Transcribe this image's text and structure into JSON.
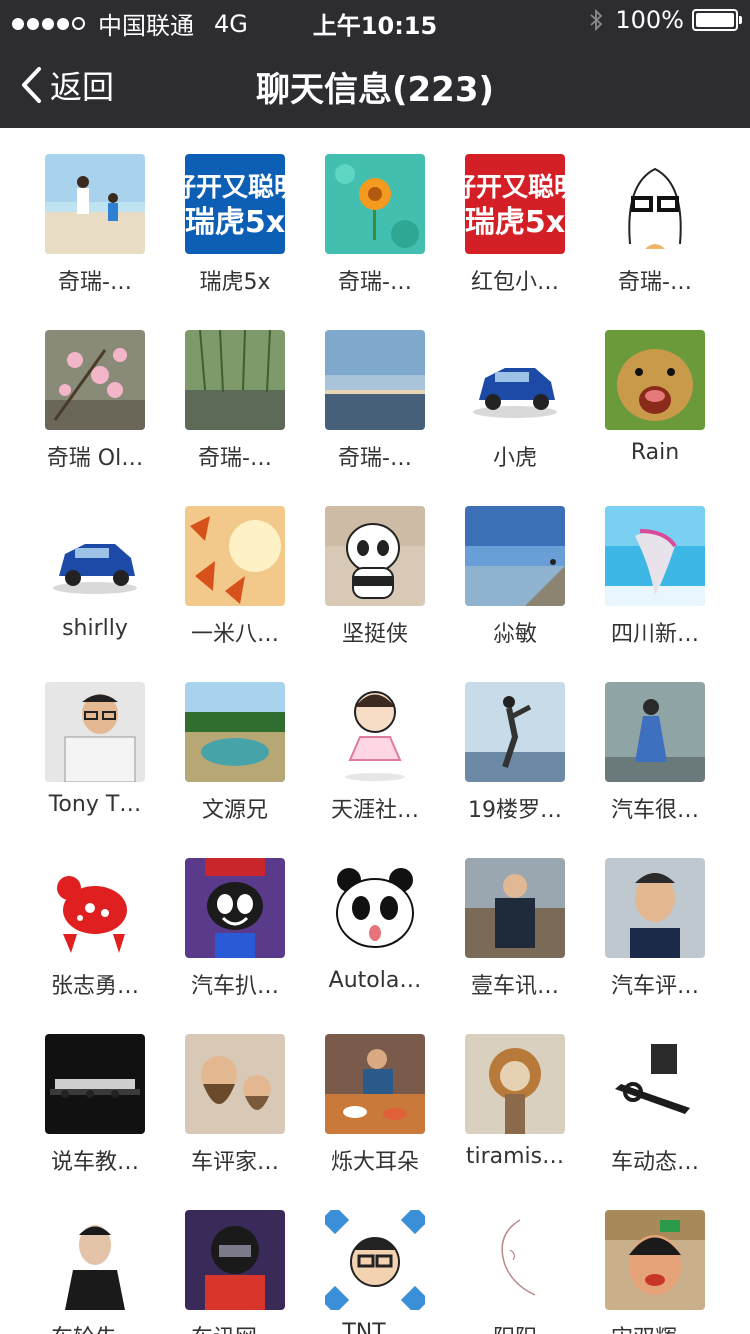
{
  "status_bar": {
    "carrier": "中国联通",
    "network": "4G",
    "time": "上午10:15",
    "battery": "100%"
  },
  "nav": {
    "back_label": "返回",
    "title": "聊天信息(223)"
  },
  "members": [
    {
      "name": "奇瑞-…",
      "avatar": "beach-photo"
    },
    {
      "name": "瑞虎5x",
      "avatar": "ruihu-logo-blue"
    },
    {
      "name": "奇瑞-…",
      "avatar": "flower-water"
    },
    {
      "name": "红包小…",
      "avatar": "ruihu-logo-red"
    },
    {
      "name": "奇瑞-…",
      "avatar": "sketch-girl"
    },
    {
      "name": "奇瑞 Ol…",
      "avatar": "blossom-photo"
    },
    {
      "name": "奇瑞-…",
      "avatar": "willow-canal"
    },
    {
      "name": "奇瑞-…",
      "avatar": "sea-sunset"
    },
    {
      "name": "小虎",
      "avatar": "blue-suv"
    },
    {
      "name": "Rain",
      "avatar": "lion-cub"
    },
    {
      "name": "shirlly",
      "avatar": "blue-suv"
    },
    {
      "name": "一米八…",
      "avatar": "autumn-leaves"
    },
    {
      "name": "坚挺侠",
      "avatar": "cartoon-panda"
    },
    {
      "name": "尛敏",
      "avatar": "lake-person"
    },
    {
      "name": "四川新…",
      "avatar": "beach-scarf"
    },
    {
      "name": "Tony T…",
      "avatar": "man-glasses"
    },
    {
      "name": "文源兄",
      "avatar": "landscape-pond"
    },
    {
      "name": "天涯社…",
      "avatar": "cartoon-ballerina"
    },
    {
      "name": "19楼罗…",
      "avatar": "man-jumping"
    },
    {
      "name": "汽车很…",
      "avatar": "woman-sitting"
    },
    {
      "name": "张志勇…",
      "avatar": "papercut-goat"
    },
    {
      "name": "汽车扒…",
      "avatar": "cartoon-cat"
    },
    {
      "name": "Autola…",
      "avatar": "panda-tongue"
    },
    {
      "name": "壹车讯…",
      "avatar": "man-greatwall"
    },
    {
      "name": "汽车评…",
      "avatar": "man-portrait"
    },
    {
      "name": "说车教…",
      "avatar": "car-lineup"
    },
    {
      "name": "车评家…",
      "avatar": "bearded-men"
    },
    {
      "name": "烁大耳朵",
      "avatar": "man-dining"
    },
    {
      "name": "tiramis…",
      "avatar": "cat-lion"
    },
    {
      "name": "车动态…",
      "avatar": "ink-pen"
    },
    {
      "name": "车轮先…",
      "avatar": "man-black-shirt"
    },
    {
      "name": "车讯网…",
      "avatar": "helmet-rider"
    },
    {
      "name": "TNT…",
      "avatar": "cartoon-glasses-man"
    },
    {
      "name": "阳阳",
      "avatar": "line-art-face"
    },
    {
      "name": "宋双辉…",
      "avatar": "woman-funny-face"
    }
  ],
  "colors": {
    "nav_background": "#2d2d31",
    "nav_text": "#ffffff",
    "page_background": "#ffffff",
    "name_text": "#333333"
  }
}
